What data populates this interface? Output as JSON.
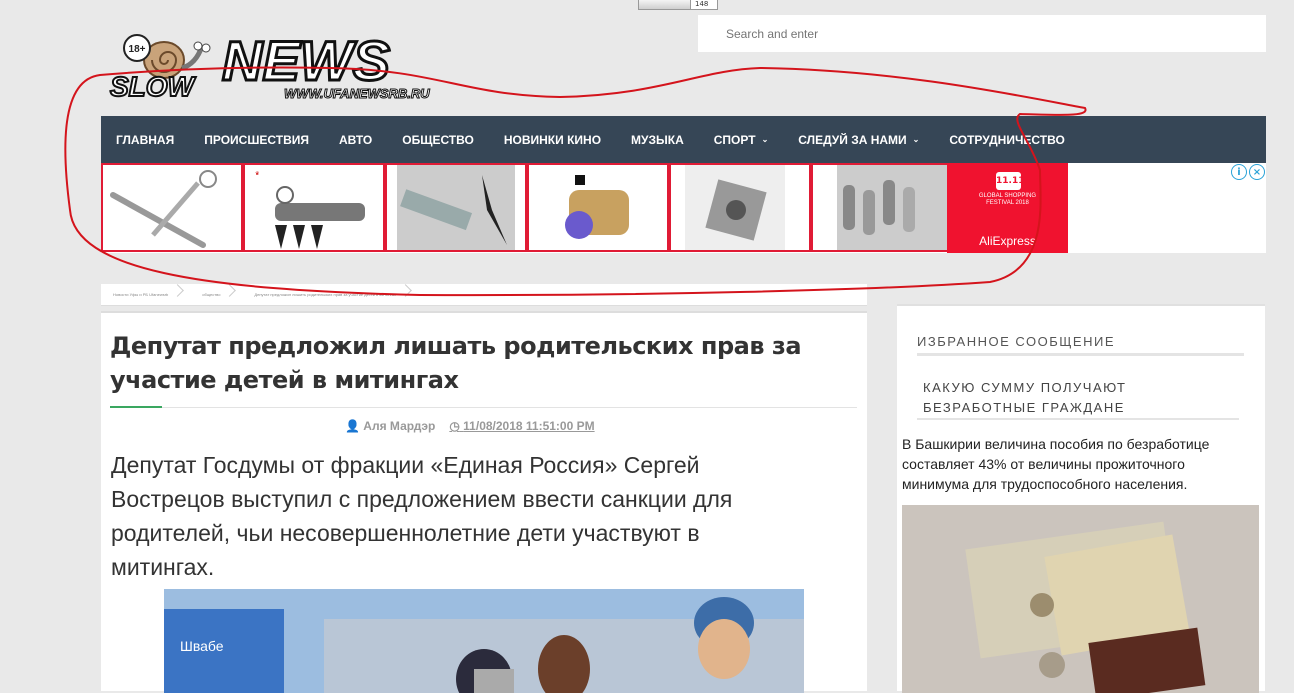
{
  "counter": {
    "value": "148"
  },
  "search": {
    "placeholder": "Search and enter"
  },
  "logo": {
    "badge": "18+",
    "word1": "SLOW",
    "word2": "NEWS",
    "url": "WWW.UFANEWSRB.RU"
  },
  "nav": {
    "items": [
      {
        "label": "ГЛАВНАЯ",
        "dropdown": false
      },
      {
        "label": "ПРОИСШЕСТВИЯ",
        "dropdown": false
      },
      {
        "label": "АВТО",
        "dropdown": false
      },
      {
        "label": "ОБЩЕСТВО",
        "dropdown": false
      },
      {
        "label": "НОВИНКИ КИНО",
        "dropdown": false
      },
      {
        "label": "МУЗЫКА",
        "dropdown": false
      },
      {
        "label": "СПОРТ",
        "dropdown": true
      },
      {
        "label": "СЛЕДУЙ ЗА НАМИ",
        "dropdown": true
      },
      {
        "label": "СОТРУДНИЧЕСТВО",
        "dropdown": false
      }
    ],
    "chevron": "⌄"
  },
  "ads": {
    "aliexpress": {
      "badge": "11.11",
      "title_line1": "GLOBAL SHOPPING",
      "title_line2": "FESTIVAL 2018",
      "brand": "AliExpress"
    },
    "adchoice": [
      "i",
      "×"
    ]
  },
  "breadcrumb": {
    "items": [
      "Новости Уфы и РБ Ufanewsrb",
      "общество",
      "Депутат предложил лишить родительских прав за участие детей в митингах"
    ]
  },
  "article": {
    "title": "Депутат предложил лишать родительских прав за участие детей в митингах",
    "author": "Аля Мардэр",
    "date": "11/08/2018 11:51:00 PM",
    "lead": "Депутат Госдумы от фракции «Единая Россия» Сергей Вострецов выступил с предложением ввести санкции для родителей, чьи несовершеннолетние дети участвуют в митингах.",
    "photo_sign": "Швабе"
  },
  "sidebar": {
    "heading": "ИЗБРАННОЕ СООБЩЕНИЕ",
    "post_title": "КАКУЮ СУММУ ПОЛУЧАЮТ БЕЗРАБОТНЫЕ ГРАЖДАНЕ",
    "post_text": "В Башкирии величина пособия по безработице составляет 43% от величины прожиточного минимума для трудоспособного населения."
  },
  "colors": {
    "nav_bg": "#364656",
    "ad_border": "#e01b35",
    "accent_green": "#3aa760",
    "scribble": "#d4141c"
  }
}
